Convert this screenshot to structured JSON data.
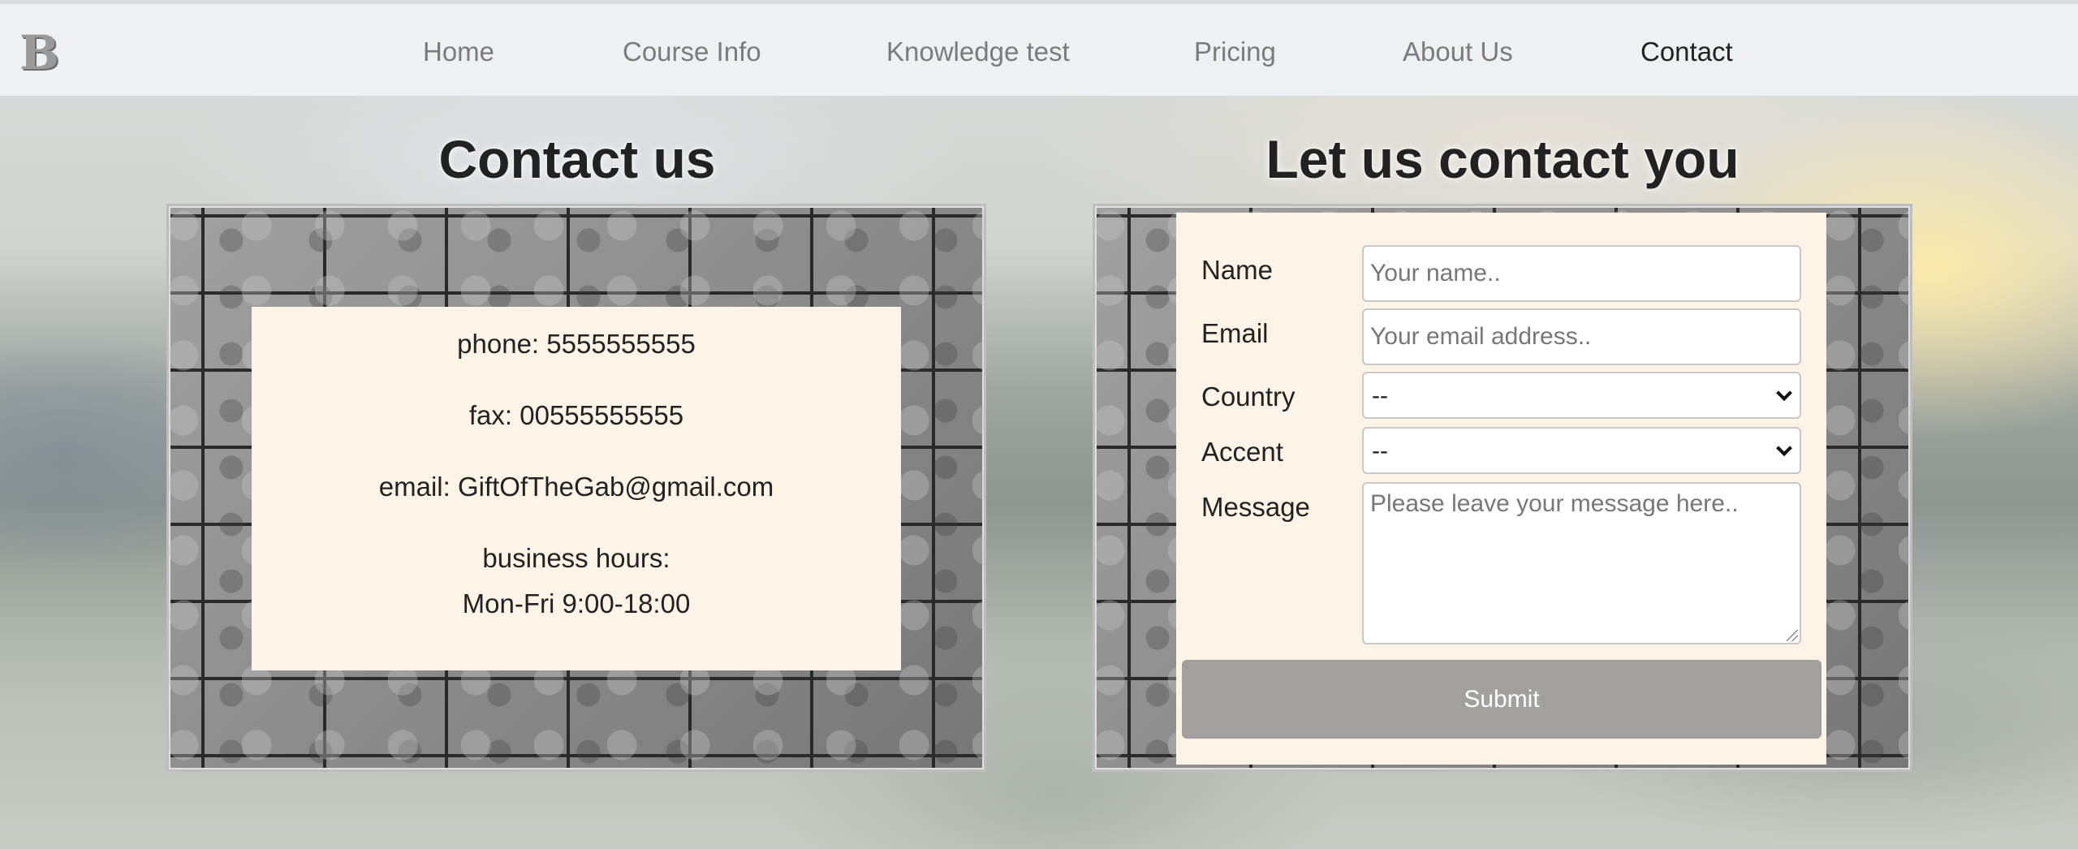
{
  "nav": {
    "logo_letter": "B",
    "items": [
      {
        "label": "Home"
      },
      {
        "label": "Course Info"
      },
      {
        "label": "Knowledge test"
      },
      {
        "label": "Pricing"
      },
      {
        "label": "About Us"
      },
      {
        "label": "Contact",
        "active": true
      }
    ]
  },
  "contact": {
    "title": "Contact us",
    "phone": "phone: 5555555555",
    "fax": "fax: 00555555555",
    "email": "email: GiftOfTheGab@gmail.com",
    "hours_label": "business hours:",
    "hours": "Mon-Fri 9:00-18:00"
  },
  "form": {
    "title": "Let us contact you",
    "name_label": "Name",
    "name_placeholder": "Your name..",
    "email_label": "Email",
    "email_placeholder": "Your email address..",
    "country_label": "Country",
    "country_value": "--",
    "accent_label": "Accent",
    "accent_value": "--",
    "message_label": "Message",
    "message_placeholder": "Please leave your message here..",
    "submit_label": "Submit"
  },
  "colors": {
    "card_background": "#fdf4e7",
    "submit_button": "#a39f9e",
    "nav_background": "#eef1f3"
  }
}
